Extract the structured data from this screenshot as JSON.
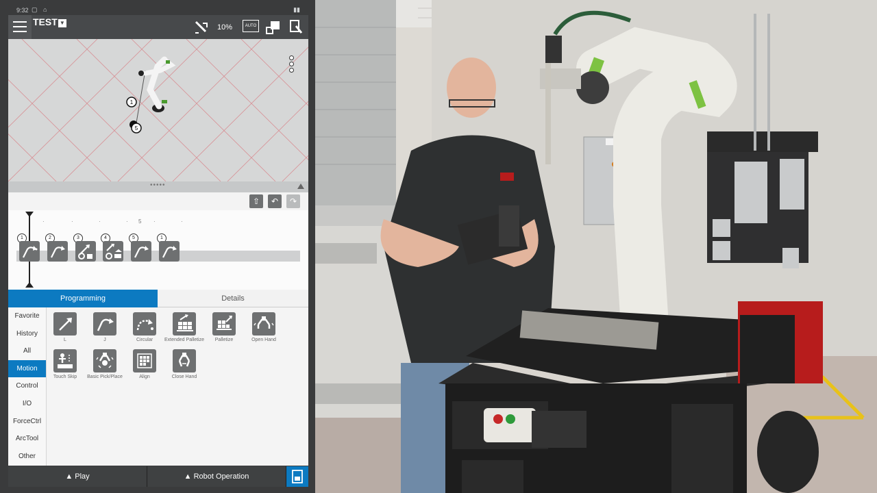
{
  "status": {
    "time": "9:32"
  },
  "topbar": {
    "program_name": "TEST",
    "speed": "10%",
    "auto_label": "AUTO"
  },
  "timeline": {
    "ruler_label": "5",
    "nodes": [
      {
        "num": "1",
        "icon": "joint-move-icon"
      },
      {
        "num": "2",
        "icon": "joint-move-icon"
      },
      {
        "num": "3",
        "icon": "touch-skip-icon"
      },
      {
        "num": "4",
        "icon": "pick-place-icon"
      },
      {
        "num": "5",
        "icon": "joint-move-icon"
      },
      {
        "num": "1",
        "icon": "joint-move-icon"
      }
    ]
  },
  "view": {
    "markers": [
      "1",
      "5"
    ]
  },
  "tabs": {
    "programming": "Programming",
    "details": "Details"
  },
  "categories": [
    "Favorite",
    "History",
    "All",
    "Motion",
    "Control",
    "I/O",
    "ForceCtrl",
    "ArcTool",
    "Other"
  ],
  "active_category": "Motion",
  "commands": [
    {
      "label": "L",
      "icon": "linear-move-icon"
    },
    {
      "label": "J",
      "icon": "joint-move-icon"
    },
    {
      "label": "Circular",
      "icon": "circular-move-icon"
    },
    {
      "label": "Extended Palletize",
      "icon": "extended-palletize-icon"
    },
    {
      "label": "Palletize",
      "icon": "palletize-icon"
    },
    {
      "label": "Open Hand",
      "icon": "open-hand-icon"
    },
    {
      "label": "Touch Skip",
      "icon": "touch-skip-icon"
    },
    {
      "label": "Basic Pick/Place",
      "icon": "pick-place-icon"
    },
    {
      "label": "Align",
      "icon": "align-icon"
    },
    {
      "label": "Close Hand",
      "icon": "close-hand-icon"
    }
  ],
  "bottombar": {
    "play": "▲ Play",
    "robot_operation": "▲ Robot Operation"
  },
  "colors": {
    "accent": "#0c7ac1",
    "robot_green": "#7dc242",
    "welder_red": "#c8102e"
  }
}
